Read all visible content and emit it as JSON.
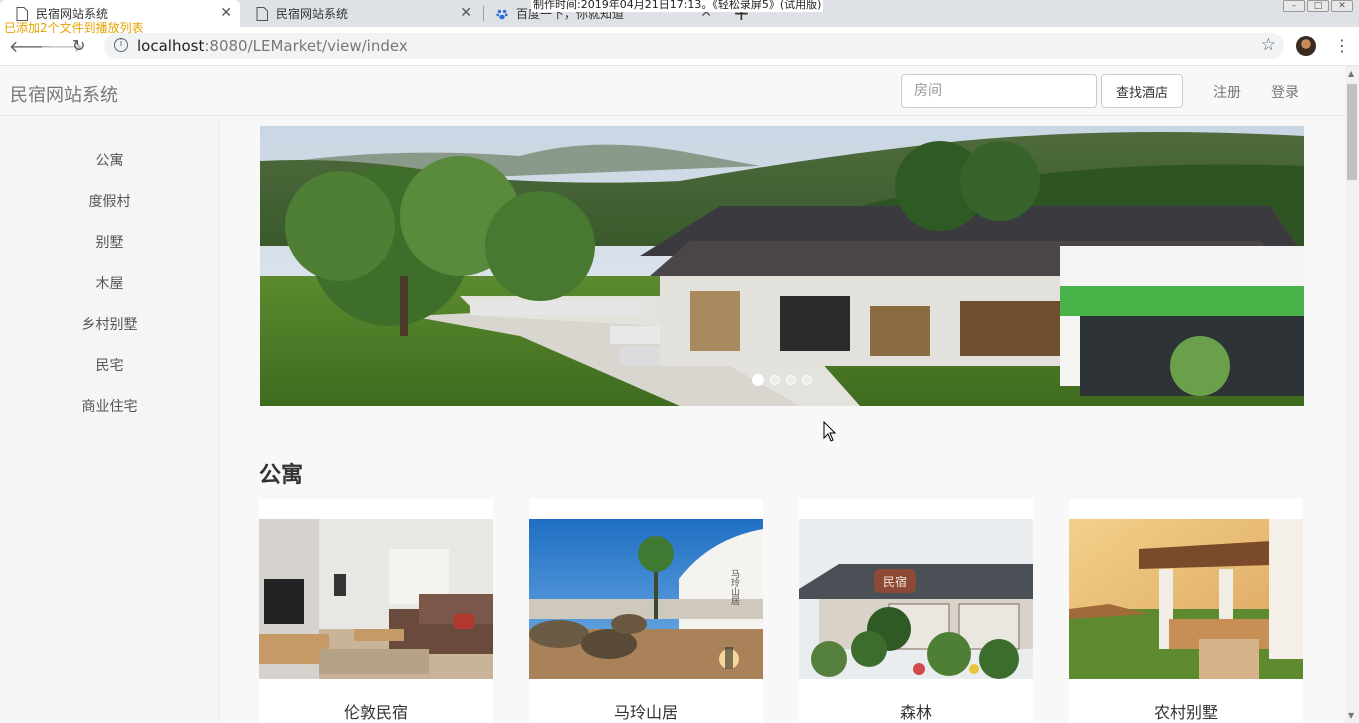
{
  "browser": {
    "tabs": [
      {
        "title": "民宿网站系统",
        "active": true
      },
      {
        "title": "民宿网站系统",
        "active": false
      },
      {
        "title": "百度一下，你就知道",
        "active": false
      }
    ],
    "newtab_glyph": "+",
    "url_host": "localhost",
    "url_rest": ":8080/LEMarket/view/index",
    "overlay_note": "已添加2个文件到播放列表",
    "overlay_rec": "制作时间:2019年04月21日17:13。《轻松录屏5》(试用版)"
  },
  "nav": {
    "brand": "民宿网站系统",
    "search_placeholder": "房间",
    "search_button": "查找酒店",
    "register": "注册",
    "login": "登录"
  },
  "sidebar": {
    "items": [
      "公寓",
      "度假村",
      "别墅",
      "木屋",
      "乡村别墅",
      "民宅",
      "商业住宅"
    ]
  },
  "carousel": {
    "slide_count": 4,
    "active_index": 0
  },
  "section": {
    "title": "公寓",
    "cards": [
      {
        "name": "伦敦民宿"
      },
      {
        "name": "马玲山居"
      },
      {
        "name": "森林"
      },
      {
        "name": "农村别墅"
      }
    ],
    "sign_text_1": "民宿",
    "sign_text_2": "马玲山居"
  },
  "colors": {
    "tabbar": "#dee1e6",
    "navbar": "#f8f8f8",
    "sidebar": "#f5f5f5",
    "overlay_note": "#e6a300"
  }
}
